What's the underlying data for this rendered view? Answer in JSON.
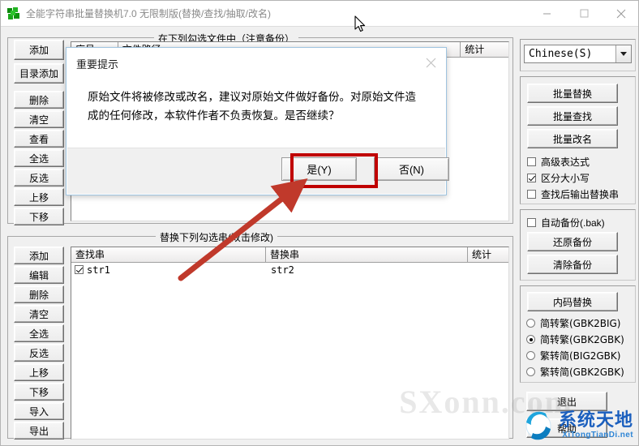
{
  "window": {
    "title": "全能字符串批量替换机7.0 无限制版(替换/查找/抽取/改名)",
    "minimize": "—",
    "maximize": "□",
    "close": "✕"
  },
  "file_group": {
    "title": "在下列勾选文件中（注意备份）",
    "buttons": [
      "添加",
      "目录添加",
      "删除",
      "清空",
      "查看",
      "全选",
      "反选",
      "上移",
      "下移"
    ],
    "columns": [
      "序号",
      "文件路径",
      "统计"
    ],
    "rows": []
  },
  "string_group": {
    "title": "替换下列勾选串(双击修改)",
    "buttons": [
      "添加",
      "编辑",
      "删除",
      "清空",
      "全选",
      "反选",
      "上移",
      "下移",
      "导入",
      "导出"
    ],
    "columns": [
      "查找串",
      "替换串",
      "统计"
    ],
    "rows": [
      {
        "checked": true,
        "find": "str1",
        "replace": "str2",
        "count": ""
      }
    ]
  },
  "right_panel": {
    "language": "Chinese(S)",
    "actions": [
      "批量替换",
      "批量查找",
      "批量改名"
    ],
    "options": [
      {
        "label": "高级表达式",
        "checked": false
      },
      {
        "label": "区分大小写",
        "checked": true
      },
      {
        "label": "查找后输出替换串",
        "checked": false
      }
    ],
    "backup": {
      "auto_label": "自动备份(.bak)",
      "auto_checked": false,
      "restore": "还原备份",
      "clear": "清除备份"
    },
    "encoding": {
      "button": "内码替换",
      "radios": [
        {
          "label": "简转繁(GBK2BIG)",
          "checked": false
        },
        {
          "label": "简转繁(GBK2GBK)",
          "checked": true
        },
        {
          "label": "繁转简(BIG2GBK)",
          "checked": false
        },
        {
          "label": "繁转简(GBK2GBK)",
          "checked": false
        }
      ]
    },
    "exit": "退出",
    "help": "帮助"
  },
  "dialog": {
    "title": "重要提示",
    "close": "✕",
    "message": "原始文件将被修改或改名，建议对原始文件做好备份。对原始文件造成的任何修改，本软件作者不负责恢复。是否继续？",
    "yes": "是(Y)",
    "no": "否(N)"
  },
  "watermark": {
    "cn": "系统天地",
    "en": "XiTongTianDi.net",
    "ghost": "SXonn.com"
  },
  "colors": {
    "highlight": "#c00000",
    "arrow": "#c0392b",
    "brand_blue": "#1b5fbe"
  }
}
